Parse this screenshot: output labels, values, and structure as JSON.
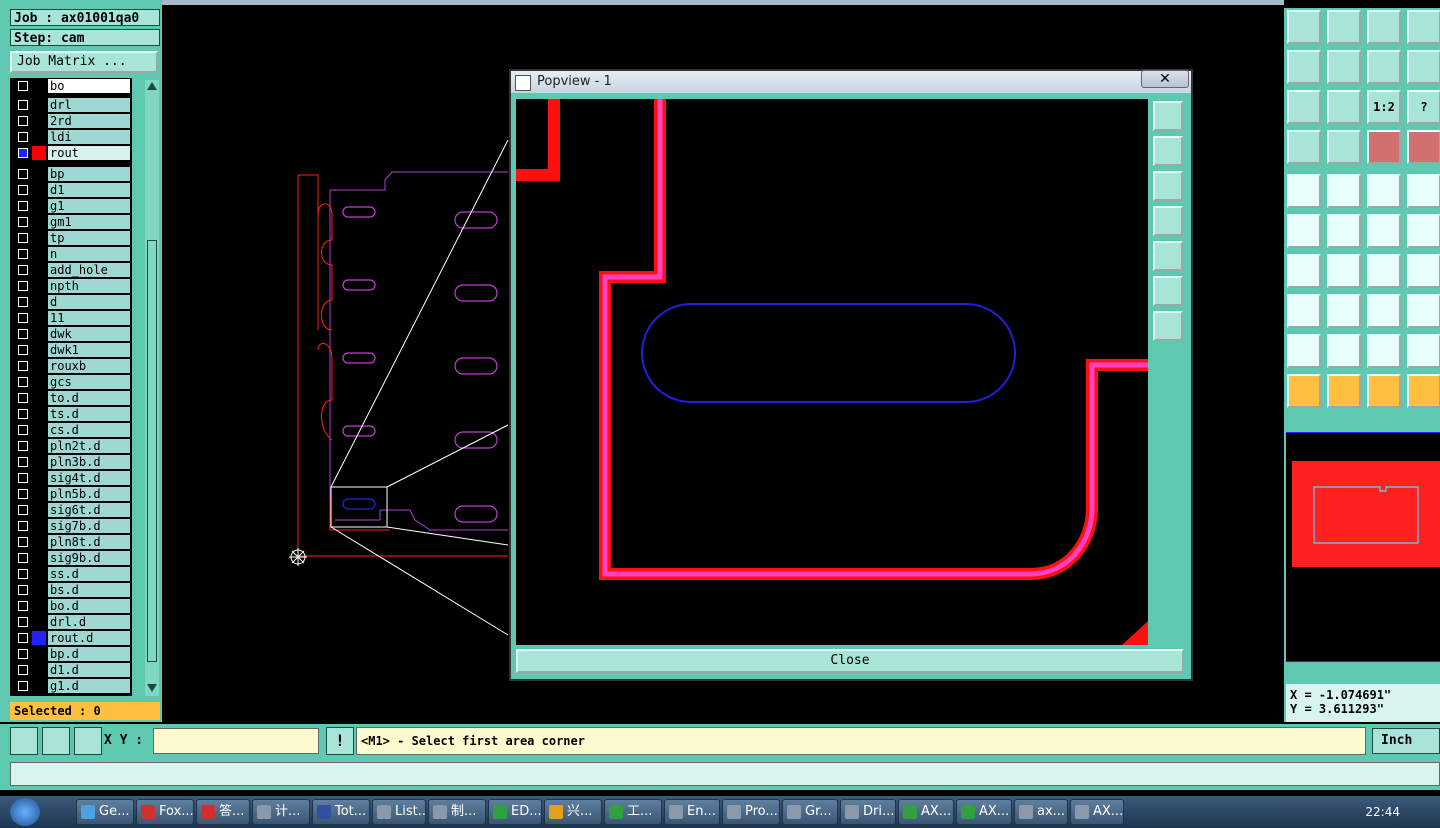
{
  "job": {
    "job_label": "Job : ax01001qa0",
    "step_label": "Step: cam",
    "matrix_button": "Job Matrix ..."
  },
  "layers": [
    {
      "name": "bo",
      "color": "#000000",
      "highlight": true
    },
    {
      "name": "drl",
      "color": "#000000"
    },
    {
      "name": "2rd",
      "color": "#000000"
    },
    {
      "name": "ldi",
      "color": "#000000"
    },
    {
      "name": "rout",
      "color": "#ff0000",
      "active": true
    },
    {
      "name": "bp",
      "color": "#000000"
    },
    {
      "name": "d1",
      "color": "#000000"
    },
    {
      "name": "g1",
      "color": "#000000"
    },
    {
      "name": "gm1",
      "color": "#000000"
    },
    {
      "name": "tp",
      "color": "#000000"
    },
    {
      "name": "n",
      "color": "#000000"
    },
    {
      "name": "add_hole",
      "color": "#000000"
    },
    {
      "name": "npth",
      "color": "#000000"
    },
    {
      "name": "d",
      "color": "#000000"
    },
    {
      "name": "11",
      "color": "#000000"
    },
    {
      "name": "dwk",
      "color": "#000000"
    },
    {
      "name": "dwk1",
      "color": "#000000"
    },
    {
      "name": "rouxb",
      "color": "#000000"
    },
    {
      "name": "gcs",
      "color": "#000000"
    },
    {
      "name": "to.d",
      "color": "#000000"
    },
    {
      "name": "ts.d",
      "color": "#000000"
    },
    {
      "name": "cs.d",
      "color": "#000000"
    },
    {
      "name": "pln2t.d",
      "color": "#000000"
    },
    {
      "name": "pln3b.d",
      "color": "#000000"
    },
    {
      "name": "sig4t.d",
      "color": "#000000"
    },
    {
      "name": "pln5b.d",
      "color": "#000000"
    },
    {
      "name": "sig6t.d",
      "color": "#000000"
    },
    {
      "name": "sig7b.d",
      "color": "#000000"
    },
    {
      "name": "pln8t.d",
      "color": "#000000"
    },
    {
      "name": "sig9b.d",
      "color": "#000000"
    },
    {
      "name": "ss.d",
      "color": "#000000"
    },
    {
      "name": "bs.d",
      "color": "#000000"
    },
    {
      "name": "bo.d",
      "color": "#000000"
    },
    {
      "name": "drl.d",
      "color": "#000000"
    },
    {
      "name": "rout.d",
      "color": "#2222ff"
    },
    {
      "name": "bp.d",
      "color": "#000000"
    },
    {
      "name": "d1.d",
      "color": "#000000"
    },
    {
      "name": "g1.d",
      "color": "#000000"
    }
  ],
  "selected_label": "Selected : 0",
  "popview": {
    "title": "Popview - 1",
    "close_x": "✕",
    "close_button": "Close"
  },
  "right_panel": {
    "ratio_label": "1:2",
    "help_label": "?"
  },
  "coords": {
    "x": "X = -1.074691\"",
    "y": "Y = 3.611293\""
  },
  "command": {
    "xy_label": "X Y :",
    "xy_value": "",
    "prompt": "<M1> - Select first area corner",
    "units": "Inch",
    "alert_label": "!"
  },
  "taskbar": {
    "tasks": [
      {
        "label": "Ge...",
        "color": "#4aa3df"
      },
      {
        "label": "Fox...",
        "color": "#d03030"
      },
      {
        "label": "答...",
        "color": "#d03030"
      },
      {
        "label": "计...",
        "color": "#8a9aaa"
      },
      {
        "label": "Tot...",
        "color": "#3050a0"
      },
      {
        "label": "List...",
        "color": "#8a9aaa"
      },
      {
        "label": "制...",
        "color": "#8a9aaa"
      },
      {
        "label": "ED...",
        "color": "#30a040"
      },
      {
        "label": "兴...",
        "color": "#e0a020"
      },
      {
        "label": "工...",
        "color": "#30a040"
      },
      {
        "label": "En...",
        "color": "#8a9aaa"
      },
      {
        "label": "Pro...",
        "color": "#8a9aaa"
      },
      {
        "label": "Gr...",
        "color": "#8a9aaa"
      },
      {
        "label": "Dri...",
        "color": "#8a9aaa"
      },
      {
        "label": "AX...",
        "color": "#30a040"
      },
      {
        "label": "AX...",
        "color": "#30a040"
      },
      {
        "label": "ax...",
        "color": "#8a9aaa"
      },
      {
        "label": "AX...",
        "color": "#8a9aaa"
      }
    ],
    "clock": "22:44"
  },
  "colors": {
    "panel": "#5fc8b0",
    "button": "#a8e4d8",
    "rout": "#ff0000",
    "magenta": "#ff3399",
    "slot": "#2222ee",
    "prompt_bg": "#fffbd0",
    "selected": "#ffc040"
  }
}
